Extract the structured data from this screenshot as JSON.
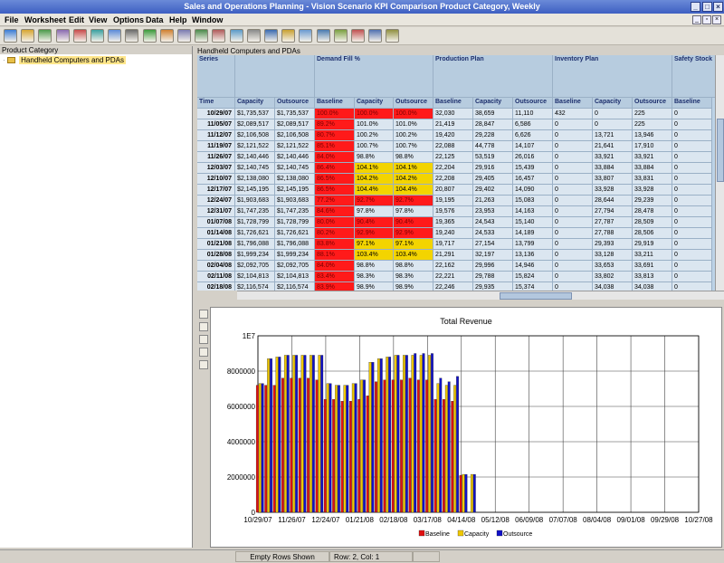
{
  "window": {
    "title": "Sales and Operations Planning - Vision Scenario KPI Comparison Product Category, Weekly"
  },
  "menu": [
    "File",
    "Worksheet",
    "Edit",
    "View",
    "Options",
    "Data",
    "Help",
    "Window"
  ],
  "toolbar": {
    "icons": [
      "new-icon",
      "open-icon",
      "save-icon",
      "print-icon",
      "export-icon",
      "import-icon",
      "report-icon",
      "chart-icon",
      "refresh-icon",
      "search-icon",
      "attach-icon",
      "calendar-icon",
      "notes-icon",
      "link-icon",
      "grid-icon",
      "table-icon",
      "bar-chart-icon",
      "window-icon",
      "view-icon",
      "layout-icon",
      "filter-icon",
      "sort-icon",
      "calc-icon"
    ]
  },
  "left_panel": {
    "header": "Product Category",
    "tree_item": "Handheld Computers and PDAs"
  },
  "grid": {
    "title": "Handheld Computers and PDAs",
    "series_label": "Series",
    "time_label": "Time",
    "groups": [
      "Demand Fill %",
      "Production Plan",
      "Inventory Plan",
      "Safety Stock"
    ],
    "columns": [
      "Capacity",
      "Outsource",
      "Baseline",
      "Capacity",
      "Outsource",
      "Baseline",
      "Capacity",
      "Outsource",
      "Baseline",
      "Capacity",
      "Outsource",
      "Baseline"
    ],
    "rows": [
      {
        "time": "10/29/07",
        "v": [
          "$1,735,537",
          "$1,735,537",
          "100.0%",
          "100.0%",
          "100.0%",
          "32,030",
          "38,659",
          "11,110",
          "432",
          "0",
          "225",
          "0"
        ],
        "fill": [
          "r",
          "r",
          "r"
        ]
      },
      {
        "time": "11/05/07",
        "v": [
          "$2,089,517",
          "$2,089,517",
          "89.2%",
          "101.0%",
          "101.0%",
          "21,419",
          "28,847",
          "6,586",
          "0",
          "0",
          "225",
          "0"
        ],
        "fill": [
          "r",
          "",
          ""
        ]
      },
      {
        "time": "11/12/07",
        "v": [
          "$2,106,508",
          "$2,106,508",
          "80.7%",
          "100.2%",
          "100.2%",
          "19,420",
          "29,228",
          "6,626",
          "0",
          "13,721",
          "13,946",
          "0"
        ],
        "fill": [
          "r",
          "",
          ""
        ]
      },
      {
        "time": "11/19/07",
        "v": [
          "$2,121,522",
          "$2,121,522",
          "85.1%",
          "100.7%",
          "100.7%",
          "22,088",
          "44,778",
          "14,107",
          "0",
          "21,641",
          "17,910",
          "0"
        ],
        "fill": [
          "r",
          "",
          ""
        ]
      },
      {
        "time": "11/26/07",
        "v": [
          "$2,140,446",
          "$2,140,446",
          "84.0%",
          "98.8%",
          "98.8%",
          "22,125",
          "53,519",
          "26,016",
          "0",
          "33,921",
          "33,921",
          "0"
        ],
        "fill": [
          "r",
          "",
          ""
        ]
      },
      {
        "time": "12/03/07",
        "v": [
          "$2,140,745",
          "$2,140,745",
          "86.4%",
          "104.1%",
          "104.1%",
          "22,204",
          "29,916",
          "15,439",
          "0",
          "33,884",
          "33,884",
          "0"
        ],
        "fill": [
          "r",
          "y",
          "y"
        ]
      },
      {
        "time": "12/10/07",
        "v": [
          "$2,138,080",
          "$2,138,080",
          "86.5%",
          "104.2%",
          "104.2%",
          "22,208",
          "29,405",
          "16,457",
          "0",
          "33,807",
          "33,831",
          "0"
        ],
        "fill": [
          "r",
          "y",
          "y"
        ]
      },
      {
        "time": "12/17/07",
        "v": [
          "$2,145,195",
          "$2,145,195",
          "86.5%",
          "104.4%",
          "104.4%",
          "20,807",
          "29,402",
          "14,090",
          "0",
          "33,928",
          "33,928",
          "0"
        ],
        "fill": [
          "r",
          "y",
          "y"
        ]
      },
      {
        "time": "12/24/07",
        "v": [
          "$1,903,683",
          "$1,903,683",
          "77.2%",
          "92.7%",
          "92.7%",
          "19,195",
          "21,263",
          "15,083",
          "0",
          "28,644",
          "29,239",
          "0"
        ],
        "fill": [
          "r",
          "r",
          "r"
        ]
      },
      {
        "time": "12/31/07",
        "v": [
          "$1,747,235",
          "$1,747,235",
          "84.6%",
          "97.8%",
          "97.8%",
          "19,576",
          "23,953",
          "14,163",
          "0",
          "27,794",
          "28,478",
          "0"
        ],
        "fill": [
          "r",
          "",
          ""
        ]
      },
      {
        "time": "01/07/08",
        "v": [
          "$1,728,799",
          "$1,728,799",
          "80.0%",
          "90.4%",
          "90.4%",
          "19,365",
          "24,543",
          "15,140",
          "0",
          "27,787",
          "28,509",
          "0"
        ],
        "fill": [
          "r",
          "r",
          "r"
        ]
      },
      {
        "time": "01/14/08",
        "v": [
          "$1,726,621",
          "$1,726,621",
          "80.2%",
          "92.9%",
          "92.9%",
          "19,240",
          "24,533",
          "14,189",
          "0",
          "27,788",
          "28,506",
          "0"
        ],
        "fill": [
          "r",
          "r",
          "r"
        ]
      },
      {
        "time": "01/21/08",
        "v": [
          "$1,796,088",
          "$1,796,088",
          "83.8%",
          "97.1%",
          "97.1%",
          "19,717",
          "27,154",
          "13,799",
          "0",
          "29,393",
          "29,919",
          "0"
        ],
        "fill": [
          "r",
          "y",
          "y"
        ]
      },
      {
        "time": "01/28/08",
        "v": [
          "$1,999,234",
          "$1,999,234",
          "88.1%",
          "103.4%",
          "103.4%",
          "21,291",
          "32,197",
          "13,136",
          "0",
          "33,128",
          "33,211",
          "0"
        ],
        "fill": [
          "r",
          "y",
          "y"
        ]
      },
      {
        "time": "02/04/08",
        "v": [
          "$2,092,705",
          "$2,092,705",
          "84.0%",
          "98.8%",
          "98.8%",
          "22,162",
          "29,996",
          "14,946",
          "0",
          "33,653",
          "33,691",
          "0"
        ],
        "fill": [
          "r",
          "",
          ""
        ]
      },
      {
        "time": "02/11/08",
        "v": [
          "$2,104,813",
          "$2,104,813",
          "83.4%",
          "98.3%",
          "98.3%",
          "22,221",
          "29,788",
          "15,824",
          "0",
          "33,802",
          "33,813",
          "0"
        ],
        "fill": [
          "r",
          "",
          ""
        ]
      },
      {
        "time": "02/18/08",
        "v": [
          "$2,116,574",
          "$2,116,574",
          "83.9%",
          "98.9%",
          "98.9%",
          "22,246",
          "29,935",
          "15,374",
          "0",
          "34,038",
          "34,038",
          "0"
        ],
        "fill": [
          "r",
          "",
          ""
        ]
      }
    ]
  },
  "colors": {
    "red": "#ff1a1a",
    "yellow": "#f3d400",
    "baseline": "#e01010",
    "capacity": "#f0c800",
    "outsource": "#1010c8"
  },
  "chart_data": {
    "type": "bar",
    "title": "Total Revenue",
    "y_ticks": [
      "0",
      "2000000",
      "4000000",
      "6000000",
      "8000000",
      "1E7"
    ],
    "ylim": [
      0,
      10000000
    ],
    "x_ticks": [
      "10/29/07",
      "11/26/07",
      "12/24/07",
      "01/21/08",
      "02/18/08",
      "03/17/08",
      "04/14/08",
      "05/12/08",
      "06/09/08",
      "07/07/08",
      "08/04/08",
      "09/01/08",
      "09/29/08",
      "10/27/08"
    ],
    "x_range": [
      "10/29/07",
      "10/27/08"
    ],
    "grid": true,
    "legend_position": "bottom",
    "series": [
      {
        "name": "Baseline",
        "values": [
          7200000,
          7200000,
          7200000,
          7600000,
          7600000,
          7600000,
          7600000,
          7500000,
          6400000,
          6400000,
          6300000,
          6300000,
          6400000,
          6600000,
          7400000,
          7500000,
          7500000,
          7500000,
          7600000,
          7500000,
          7500000,
          6400000,
          6400000,
          6300000,
          2100000,
          0
        ]
      },
      {
        "name": "Capacity",
        "values": [
          7300000,
          8700000,
          8800000,
          8900000,
          8900000,
          8900000,
          8900000,
          8900000,
          7300000,
          7200000,
          7200000,
          7300000,
          7500000,
          8500000,
          8700000,
          8800000,
          8900000,
          8900000,
          8900000,
          8900000,
          8900000,
          7300000,
          7200000,
          7200000,
          2150000,
          2150000
        ]
      },
      {
        "name": "Outsource",
        "values": [
          7300000,
          8700000,
          8800000,
          8900000,
          8900000,
          8900000,
          8900000,
          8900000,
          7300000,
          7200000,
          7200000,
          7300000,
          7500000,
          8500000,
          8700000,
          8800000,
          8900000,
          8900000,
          9000000,
          9000000,
          9000000,
          7600000,
          7400000,
          7700000,
          2150000,
          2150000
        ]
      }
    ]
  },
  "status": {
    "empty_rows": "Empty Rows Shown",
    "position": "Row: 2, Col: 1"
  }
}
